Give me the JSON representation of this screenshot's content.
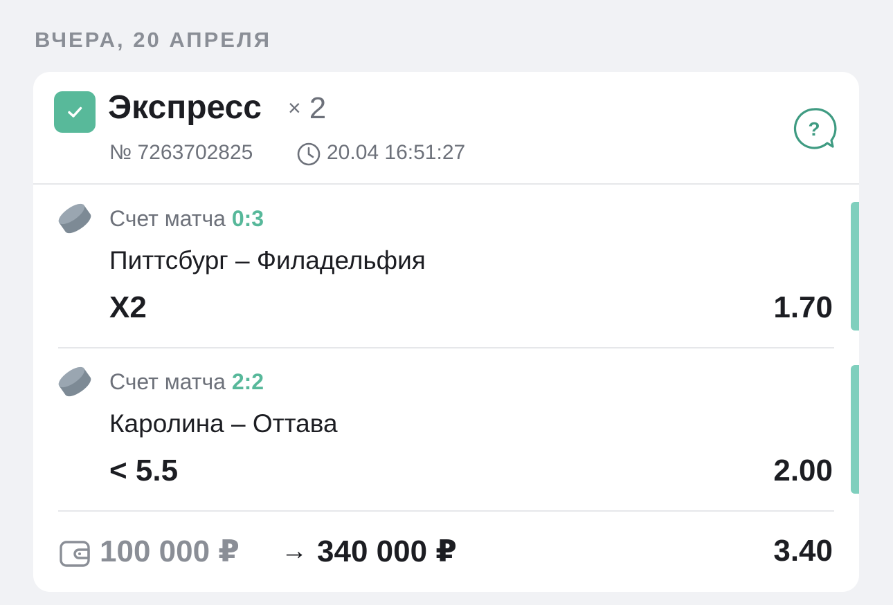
{
  "date_header": "ВЧЕРА, 20 АПРЕЛЯ",
  "bet": {
    "type": "Экспресс",
    "count_prefix": "×",
    "count": "2",
    "number": "№ 7263702825",
    "time": "20.04 16:51:27",
    "status_color": "#58b99a"
  },
  "icons": {
    "status": "check-icon",
    "help": "help-bubble-icon",
    "time": "clock-icon",
    "sport": "hockey-puck-icon",
    "wallet": "wallet-icon"
  },
  "events": [
    {
      "score_label": "Счет матча",
      "score": "0:3",
      "teams": "Питтсбург – Филадельфия",
      "outcome": "X2",
      "odds": "1.70"
    },
    {
      "score_label": "Счет матча",
      "score": "2:2",
      "teams": "Каролина – Оттава",
      "outcome": "< 5.5",
      "odds": "2.00"
    }
  ],
  "footer": {
    "stake": "100 000 ₽",
    "arrow": "→",
    "payout": "340 000 ₽",
    "total_odds": "3.40"
  },
  "colors": {
    "accent": "#58b99a",
    "win_bar": "#7fcfbd",
    "muted_text": "#6d717a"
  }
}
